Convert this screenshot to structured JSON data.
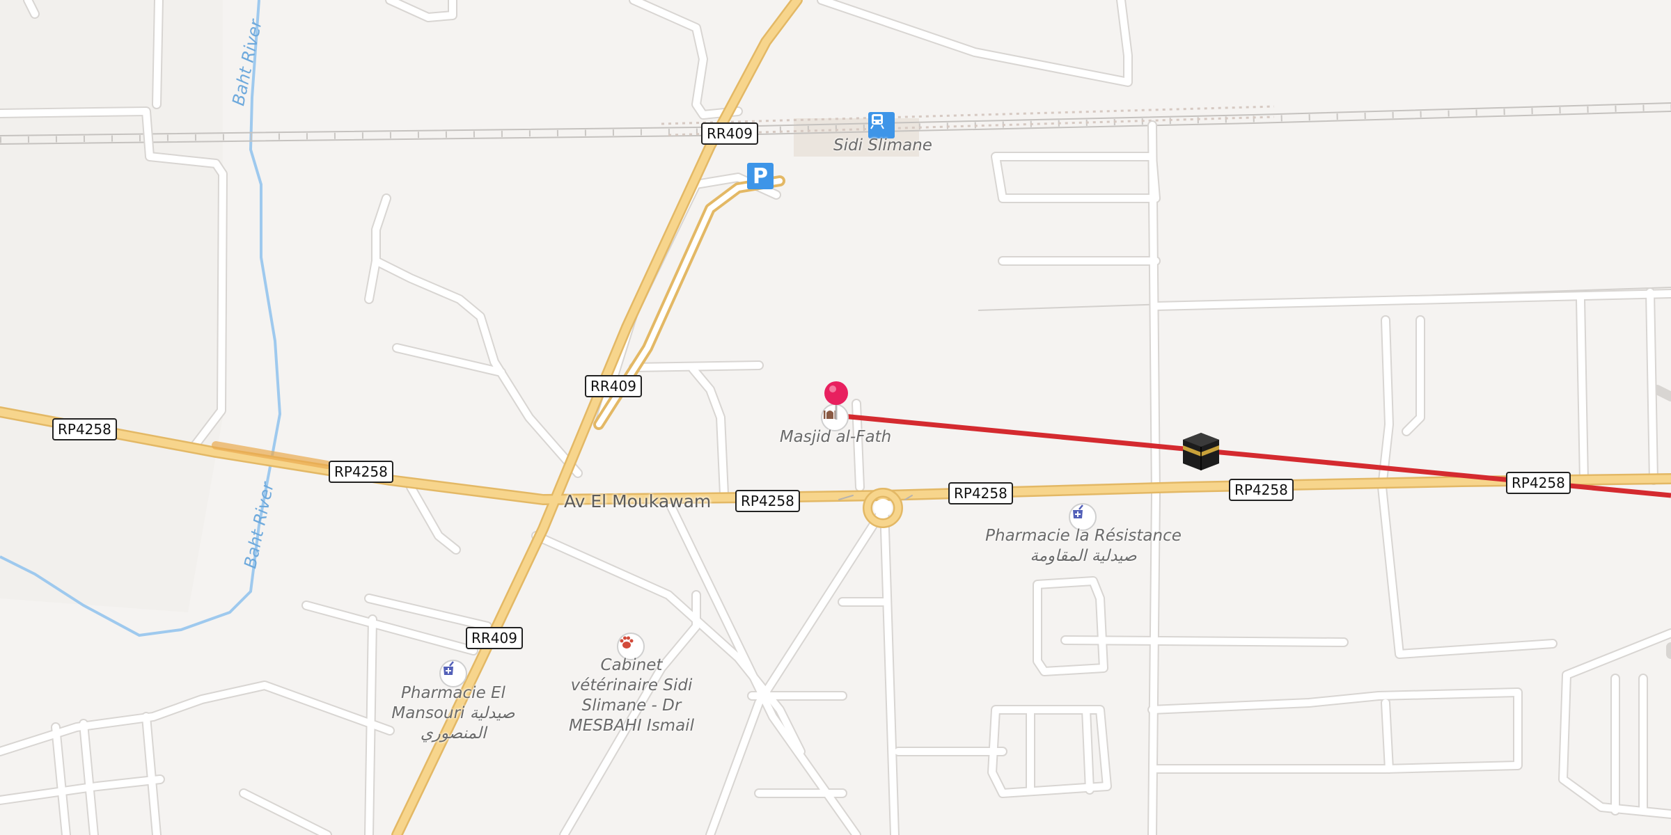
{
  "road_shields": {
    "rr409_top": "RR409",
    "rr409_mid": "RR409",
    "rr409_bottom": "RR409",
    "rp4258_left": "RP4258",
    "rp4258_2": "RP4258",
    "rp4258_3": "RP4258",
    "rp4258_4": "RP4258",
    "rp4258_5": "RP4258",
    "rp4258_right": "RP4258"
  },
  "streets": {
    "av_el_moukawam": "Av El Moukawam"
  },
  "rivers": {
    "upper": "Baht River",
    "lower": "Baht River"
  },
  "places": {
    "station": "Sidi Slimane",
    "mosque": "Masjid al-Fath",
    "pharmacie_resistance": "Pharmacie la Résistance",
    "pharmacie_resistance_ar": "صيدلية المقاومة",
    "veterinaire": "Cabinet vétérinaire Sidi Slimane - Dr MESBAHI Ismail",
    "pharmacie_mansouri": "Pharmacie El Mansouri صيدلية المنصوري"
  },
  "icons": {
    "parking": "P",
    "station": "train-station-icon",
    "mosque": "mosque-icon",
    "pharmacy": "pharmacy-icon",
    "veterinary": "paw-icon",
    "kaaba": "kaaba-icon",
    "pin": "location-pin-icon"
  },
  "colors": {
    "background": "#f5f3f1",
    "main_road": "#f7d58c",
    "water": "#9ec9ee",
    "qibla_line": "#d42a2f",
    "pin": "#e8205f"
  }
}
